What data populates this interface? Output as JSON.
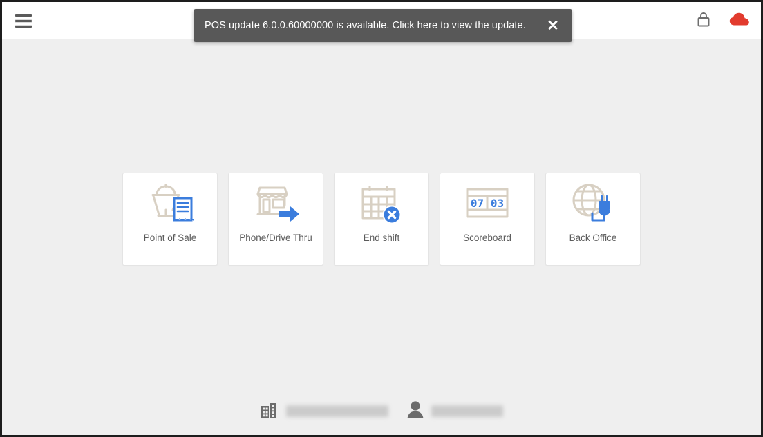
{
  "header": {
    "menu_icon": "hamburger-menu-icon",
    "lock_icon": "lock-icon",
    "cloud_icon": "cloud-offline-icon",
    "lock_color": "#6e6e6e",
    "cloud_color": "#e23b2e"
  },
  "snackbar": {
    "message": "POS update 6.0.0.60000000 is available. Click here to view the update.",
    "close_label": "✕",
    "close_icon": "close-icon",
    "background": "#585858"
  },
  "tiles": [
    {
      "label": "Point of Sale",
      "icon": "food-tray-receipt-icon"
    },
    {
      "label": "Phone/Drive Thru",
      "icon": "storefront-arrow-icon"
    },
    {
      "label": "End shift",
      "icon": "calendar-cancel-icon"
    },
    {
      "label": "Scoreboard",
      "icon": "scoreboard-icon"
    },
    {
      "label": "Back Office",
      "icon": "globe-plug-icon"
    }
  ],
  "scoreboard": {
    "left_digits": "07",
    "right_digits": "03"
  },
  "footer": {
    "store_icon": "building-icon",
    "store_name": "",
    "user_icon": "person-icon",
    "user_name": ""
  },
  "colors": {
    "page_background": "#efefef",
    "tile_background": "#ffffff",
    "icon_beige": "#d8d0c3",
    "icon_blue": "#3b7ddd",
    "label_text": "#5b5b5b"
  }
}
